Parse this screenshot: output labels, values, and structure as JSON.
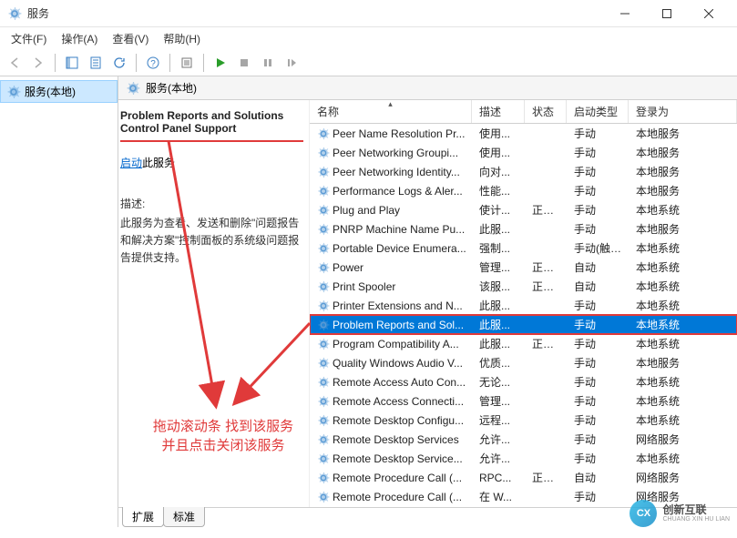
{
  "window": {
    "title": "服务"
  },
  "menu": {
    "file": "文件(F)",
    "action": "操作(A)",
    "view": "查看(V)",
    "help": "帮助(H)"
  },
  "tree": {
    "root": "服务(本地)"
  },
  "mainHeader": "服务(本地)",
  "detail": {
    "title": "Problem Reports and Solutions Control Panel Support",
    "startLink": "启动",
    "startSuffix": "此服务",
    "descLabel": "描述:",
    "descText": "此服务为查看、发送和删除\"问题报告和解决方案\"控制面板的系统级问题报告提供支持。"
  },
  "columns": {
    "name": "名称",
    "desc": "描述",
    "status": "状态",
    "startup": "启动类型",
    "logon": "登录为"
  },
  "services": [
    {
      "name": "Peer Name Resolution Pr...",
      "desc": "使用...",
      "status": "",
      "startup": "手动",
      "logon": "本地服务"
    },
    {
      "name": "Peer Networking Groupi...",
      "desc": "使用...",
      "status": "",
      "startup": "手动",
      "logon": "本地服务"
    },
    {
      "name": "Peer Networking Identity...",
      "desc": "向对...",
      "status": "",
      "startup": "手动",
      "logon": "本地服务"
    },
    {
      "name": "Performance Logs & Aler...",
      "desc": "性能...",
      "status": "",
      "startup": "手动",
      "logon": "本地服务"
    },
    {
      "name": "Plug and Play",
      "desc": "使计...",
      "status": "正在...",
      "startup": "手动",
      "logon": "本地系统"
    },
    {
      "name": "PNRP Machine Name Pu...",
      "desc": "此服...",
      "status": "",
      "startup": "手动",
      "logon": "本地服务"
    },
    {
      "name": "Portable Device Enumera...",
      "desc": "强制...",
      "status": "",
      "startup": "手动(触发...",
      "logon": "本地系统"
    },
    {
      "name": "Power",
      "desc": "管理...",
      "status": "正在...",
      "startup": "自动",
      "logon": "本地系统"
    },
    {
      "name": "Print Spooler",
      "desc": "该服...",
      "status": "正在...",
      "startup": "自动",
      "logon": "本地系统"
    },
    {
      "name": "Printer Extensions and N...",
      "desc": "此服...",
      "status": "",
      "startup": "手动",
      "logon": "本地系统"
    },
    {
      "name": "Problem Reports and Sol...",
      "desc": "此服...",
      "status": "",
      "startup": "手动",
      "logon": "本地系统",
      "selected": true
    },
    {
      "name": "Program Compatibility A...",
      "desc": "此服...",
      "status": "正在...",
      "startup": "手动",
      "logon": "本地系统"
    },
    {
      "name": "Quality Windows Audio V...",
      "desc": "优质...",
      "status": "",
      "startup": "手动",
      "logon": "本地服务"
    },
    {
      "name": "Remote Access Auto Con...",
      "desc": "无论...",
      "status": "",
      "startup": "手动",
      "logon": "本地系统"
    },
    {
      "name": "Remote Access Connecti...",
      "desc": "管理...",
      "status": "",
      "startup": "手动",
      "logon": "本地系统"
    },
    {
      "name": "Remote Desktop Configu...",
      "desc": "远程...",
      "status": "",
      "startup": "手动",
      "logon": "本地系统"
    },
    {
      "name": "Remote Desktop Services",
      "desc": "允许...",
      "status": "",
      "startup": "手动",
      "logon": "网络服务"
    },
    {
      "name": "Remote Desktop Service...",
      "desc": "允许...",
      "status": "",
      "startup": "手动",
      "logon": "本地系统"
    },
    {
      "name": "Remote Procedure Call (...",
      "desc": "RPC...",
      "status": "正在...",
      "startup": "自动",
      "logon": "网络服务"
    },
    {
      "name": "Remote Procedure Call (...",
      "desc": "在 W...",
      "status": "",
      "startup": "手动",
      "logon": "网络服务"
    }
  ],
  "tabs": {
    "extended": "扩展",
    "standard": "标准"
  },
  "annotation": {
    "line1": "拖动滚动条  找到该服务",
    "line2": "并且点击关闭该服务"
  },
  "watermark": {
    "badge": "CX",
    "text1": "创新互联",
    "text2": "CHUANG XIN HU LIAN"
  }
}
